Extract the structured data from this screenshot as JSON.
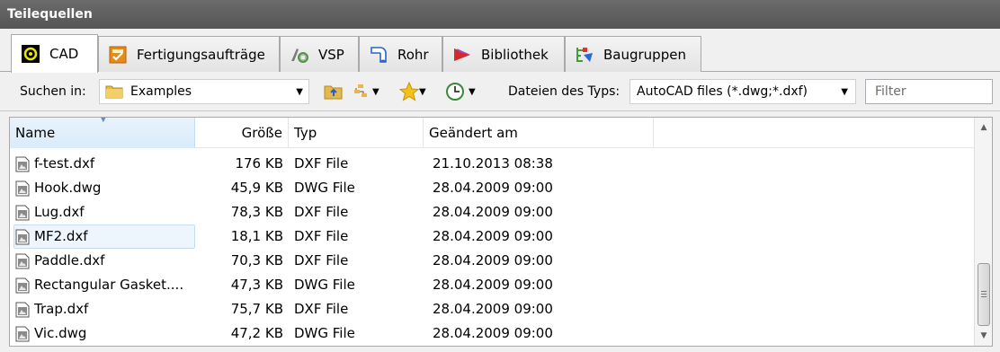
{
  "panel": {
    "title": "Teilequellen"
  },
  "tabs": [
    {
      "label": "CAD",
      "icon": "cad-icon",
      "active": true
    },
    {
      "label": "Fertigungsaufträge",
      "icon": "orders-icon",
      "active": false
    },
    {
      "label": "VSP",
      "icon": "vsp-icon",
      "active": false
    },
    {
      "label": "Rohr",
      "icon": "tube-icon",
      "active": false
    },
    {
      "label": "Bibliothek",
      "icon": "library-icon",
      "active": false
    },
    {
      "label": "Baugruppen",
      "icon": "assemblies-icon",
      "active": false
    }
  ],
  "toolbar": {
    "search_in_label": "Suchen in:",
    "folder_value": "Examples",
    "file_type_label": "Dateien des Typs:",
    "file_type_value": "AutoCAD files (*.dwg;*.dxf)",
    "filter_placeholder": "Filter"
  },
  "columns": {
    "name": "Name",
    "size": "Größe",
    "type": "Typ",
    "modified": "Geändert am"
  },
  "files": [
    {
      "name": "f-test.dxf",
      "size": "176 KB",
      "type": "DXF File",
      "modified": "21.10.2013 08:38"
    },
    {
      "name": "Hook.dwg",
      "size": "45,9 KB",
      "type": "DWG File",
      "modified": "28.04.2009 09:00"
    },
    {
      "name": "Lug.dxf",
      "size": "78,3 KB",
      "type": "DXF File",
      "modified": "28.04.2009 09:00"
    },
    {
      "name": "MF2.dxf",
      "size": "18,1 KB",
      "type": "DXF File",
      "modified": "28.04.2009 09:00"
    },
    {
      "name": "Paddle.dxf",
      "size": "70,3 KB",
      "type": "DXF File",
      "modified": "28.04.2009 09:00"
    },
    {
      "name": "Rectangular Gasket....",
      "size": "47,3 KB",
      "type": "DWG File",
      "modified": "28.04.2009 09:00"
    },
    {
      "name": "Trap.dxf",
      "size": "75,7 KB",
      "type": "DXF File",
      "modified": "28.04.2009 09:00"
    },
    {
      "name": "Vic.dwg",
      "size": "47,2 KB",
      "type": "DWG File",
      "modified": "28.04.2009 09:00"
    }
  ],
  "colors": {
    "header_bg": "#5f5f5f",
    "tab_border": "#a9a9a9",
    "sort_column": "#dcecfb",
    "highlight_row": "#eef6fd"
  }
}
